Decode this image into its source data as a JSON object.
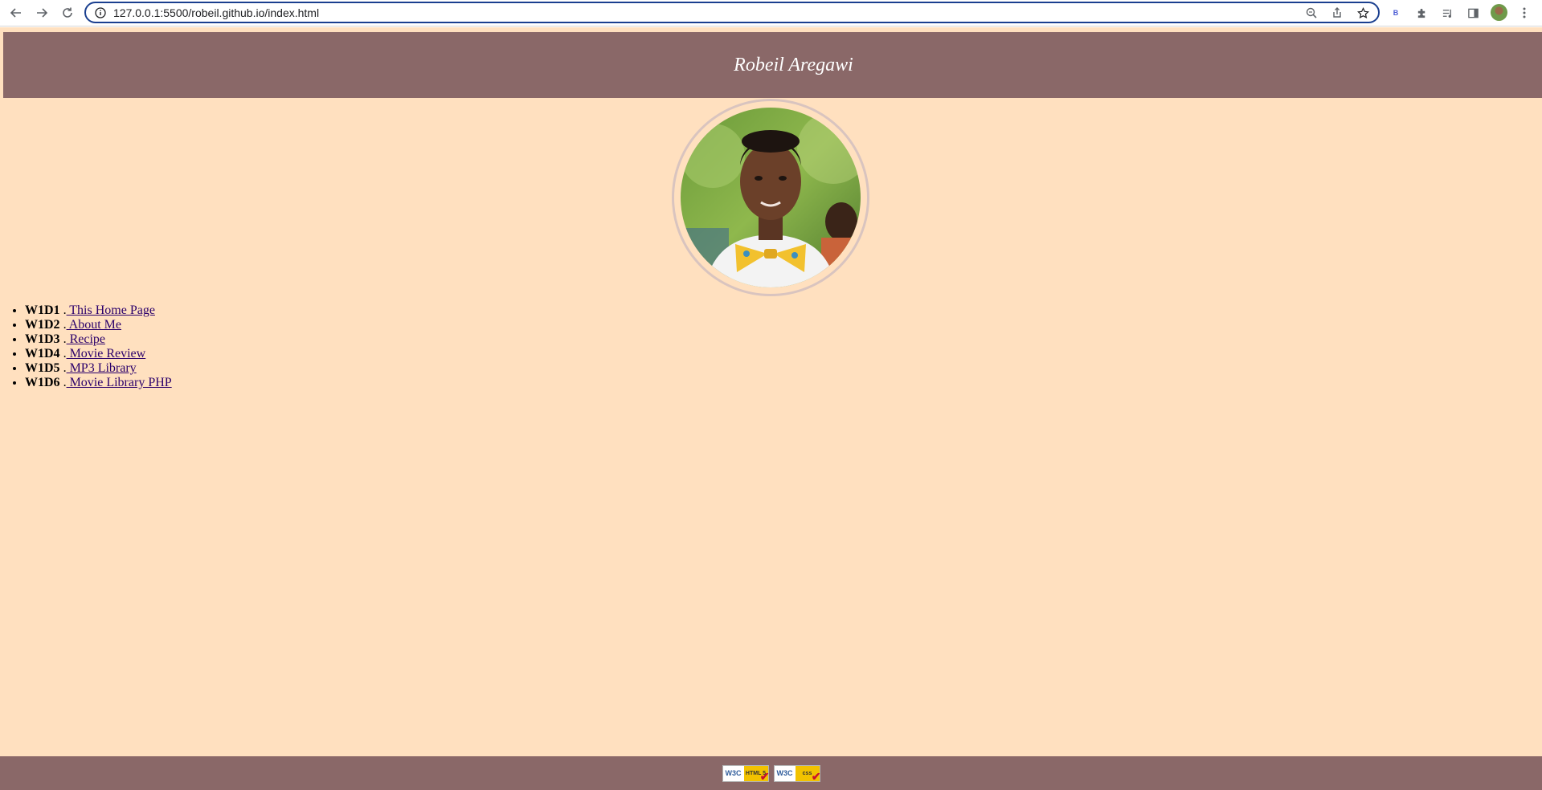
{
  "browser": {
    "url": "127.0.0.1:5500/robeil.github.io/index.html",
    "toolbar_icons": [
      "back-icon",
      "forward-icon",
      "reload-icon",
      "site-info-icon",
      "zoom-icon",
      "share-icon",
      "bookmark-star-icon",
      "extension-b-icon",
      "extensions-puzzle-icon",
      "media-controls-icon",
      "side-panel-icon",
      "profile-avatar",
      "menu-kebab-icon"
    ],
    "extension_letter": "B"
  },
  "header": {
    "title": "Robeil Aregawi"
  },
  "profile_photo": {
    "alt": "Robeil Aregawi"
  },
  "weeks": [
    {
      "code": "W1D1",
      "sep": " .",
      "link": " This Home Page"
    },
    {
      "code": "W1D2",
      "sep": " .",
      "link": " About Me"
    },
    {
      "code": "W1D3",
      "sep": " .",
      "link": " Recipe"
    },
    {
      "code": "W1D4",
      "sep": " .",
      "link": " Movie Review"
    },
    {
      "code": "W1D5",
      "sep": " .",
      "link": " MP3 Library"
    },
    {
      "code": "W1D6",
      "sep": " .",
      "link": " Movie Library PHP"
    }
  ],
  "footer": {
    "html_badge": {
      "org": "W3C",
      "kind": "HTML 5"
    },
    "css_badge": {
      "org": "W3C",
      "kind": "css"
    }
  },
  "colors": {
    "header_bg": "#8a6868",
    "page_bg": "#ffe0bf",
    "link": "#2b006b",
    "address_border": "#1a3f8f"
  }
}
